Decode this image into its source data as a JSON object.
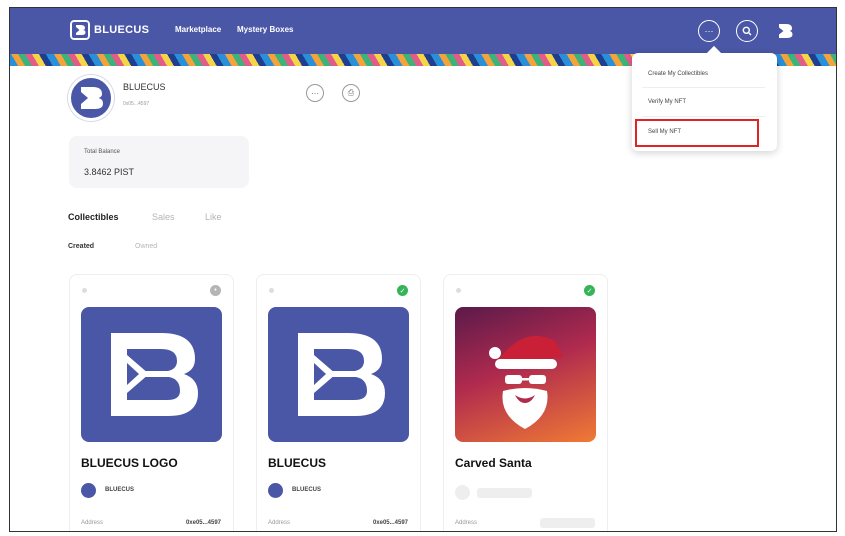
{
  "header": {
    "logo_text": "BLUECUS",
    "nav": [
      "Marketplace",
      "Mystery Boxes"
    ],
    "icons": [
      "more-icon",
      "search-icon",
      "bluecus-logo-icon"
    ]
  },
  "profile": {
    "name": "BLUECUS",
    "address": "0x05...4597"
  },
  "balance": {
    "label": "Total Balance",
    "value": "3.8462 PIST"
  },
  "tabs": [
    "Collectibles",
    "Sales",
    "Like"
  ],
  "subtabs": [
    "Created",
    "Owned"
  ],
  "cards": [
    {
      "title": "BLUECUS LOGO",
      "creator": "BLUECUS",
      "address_label": "Address",
      "address": "0xe05...4597",
      "badge": "pending",
      "image": "bluecus-logo"
    },
    {
      "title": "BLUECUS",
      "creator": "BLUECUS",
      "address_label": "Address",
      "address": "0xe05...4597",
      "badge": "verified",
      "image": "bluecus-logo"
    },
    {
      "title": "Carved Santa",
      "creator": "",
      "address_label": "Address",
      "address": "",
      "badge": "verified",
      "image": "santa"
    }
  ],
  "dropdown": {
    "items": [
      "Create My Collectibles",
      "Verify My NFT",
      "Sell My NFT"
    ],
    "highlighted": "Sell My NFT"
  },
  "colors": {
    "brand": "#4a57a6",
    "verified": "#35b45a",
    "highlight": "#e02424"
  }
}
